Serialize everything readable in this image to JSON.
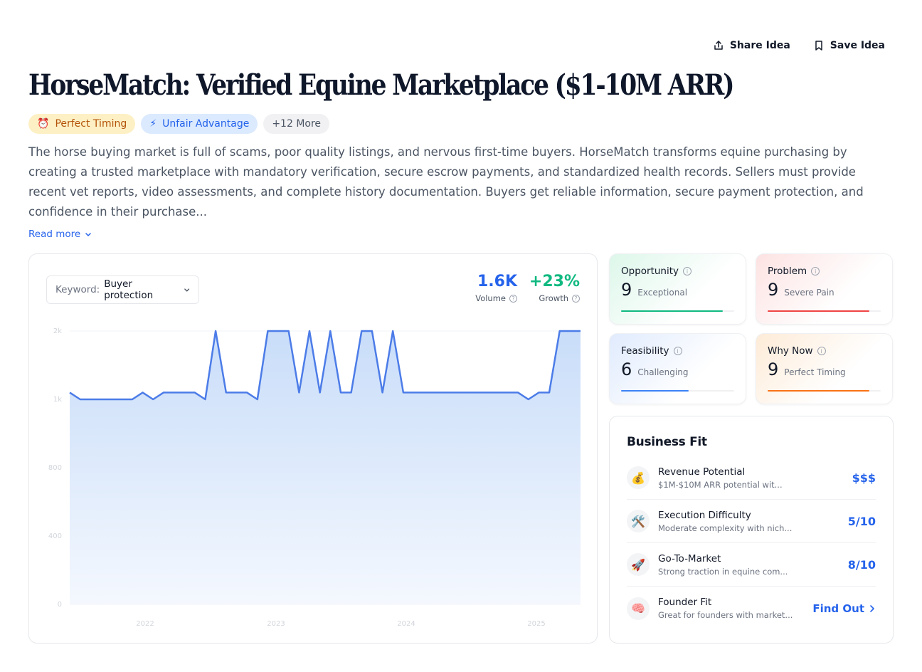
{
  "actions": {
    "share": "Share Idea",
    "save": "Save Idea"
  },
  "title": "HorseMatch: Verified Equine Marketplace ($1-10M ARR)",
  "tags": [
    {
      "icon": "⏰",
      "label": "Perfect Timing"
    },
    {
      "icon": "⚡",
      "label": "Unfair Advantage"
    },
    {
      "label": "+12 More"
    }
  ],
  "description": "The horse buying market is full of scams, poor quality listings, and nervous first-time buyers. HorseMatch transforms equine purchasing by creating a trusted marketplace with mandatory verification, secure escrow payments, and standardized health records. Sellers must provide recent vet reports, video assessments, and complete history documentation. Buyers get reliable information, secure payment protection, and confidence in their purchase...",
  "read_more": "Read more",
  "keyword": {
    "label": "Keyword:",
    "value": "Buyer protection"
  },
  "stats": {
    "volume": {
      "value": "1.6K",
      "label": "Volume"
    },
    "growth": {
      "value": "+23%",
      "label": "Growth"
    }
  },
  "chart_data": {
    "type": "area",
    "y_ticks": [
      "2k",
      "1k",
      "800",
      "400",
      "0"
    ],
    "x_ticks": [
      "2022",
      "2023",
      "2024",
      "2025"
    ],
    "values": [
      1100,
      1000,
      1000,
      1000,
      1000,
      1000,
      1000,
      1100,
      1000,
      1100,
      1100,
      1100,
      1100,
      1000,
      2000,
      1100,
      1100,
      1100,
      1000,
      2000,
      2000,
      2000,
      1100,
      2000,
      1100,
      2000,
      1100,
      1100,
      2000,
      2000,
      1100,
      2000,
      1100,
      1100,
      1100,
      1100,
      1100,
      1100,
      1100,
      1100,
      1100,
      1100,
      1100,
      1100,
      1000,
      1100,
      1100,
      2000,
      2000,
      2000
    ],
    "color": "#4c7ce8"
  },
  "scores": {
    "opportunity": {
      "name": "Opportunity",
      "score": "9",
      "verdict": "Exceptional",
      "fill": 0.9
    },
    "problem": {
      "name": "Problem",
      "score": "9",
      "verdict": "Severe Pain",
      "fill": 0.9
    },
    "feasibility": {
      "name": "Feasibility",
      "score": "6",
      "verdict": "Challenging",
      "fill": 0.6
    },
    "why_now": {
      "name": "Why Now",
      "score": "9",
      "verdict": "Perfect Timing",
      "fill": 0.9
    }
  },
  "business_fit": {
    "title": "Business Fit",
    "rows": [
      {
        "icon": "💰",
        "name": "Revenue Potential",
        "sub": "$1M-$10M ARR potential wit...",
        "value": "$$$"
      },
      {
        "icon": "🛠️",
        "name": "Execution Difficulty",
        "sub": "Moderate complexity with nich...",
        "value": "5/10"
      },
      {
        "icon": "🚀",
        "name": "Go-To-Market",
        "sub": "Strong traction in equine com...",
        "value": "8/10"
      },
      {
        "icon": "🧠",
        "name": "Founder Fit",
        "sub": "Great for founders with market...",
        "value": "Find Out"
      }
    ]
  }
}
